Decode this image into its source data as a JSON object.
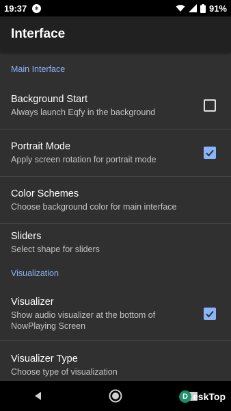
{
  "status": {
    "time": "19:37",
    "notif_glyph": "❄",
    "battery": "91%"
  },
  "app_bar": {
    "title": "Interface"
  },
  "categories": {
    "main": "Main Interface",
    "visualization": "Visualization"
  },
  "prefs": [
    {
      "title": "Background Start",
      "summary": "Always launch Eqfy in the background",
      "checked": false
    },
    {
      "title": "Portrait Mode",
      "summary": "Apply screen rotation for portrait mode",
      "checked": true
    },
    {
      "title": "Color Schemes",
      "summary": "Choose background color for main interface"
    },
    {
      "title": "Sliders",
      "summary": "Select shape for sliders"
    },
    {
      "title": "Visualizer",
      "summary": "Show audio visualizer at the bottom of NowPlaying Screen",
      "checked": true
    },
    {
      "title": "Visualizer Type",
      "summary": "Choose type of visualization"
    }
  ],
  "watermark": {
    "logo": "D",
    "text": "eskTop"
  },
  "colors": {
    "accent": "#8ab4f8",
    "background": "#303030",
    "app_bar": "#212121"
  },
  "icons": [
    "notification-icon",
    "wifi-icon",
    "signal-icon",
    "battery-icon",
    "back-icon",
    "home-icon",
    "recents-icon",
    "checkbox-icon"
  ]
}
